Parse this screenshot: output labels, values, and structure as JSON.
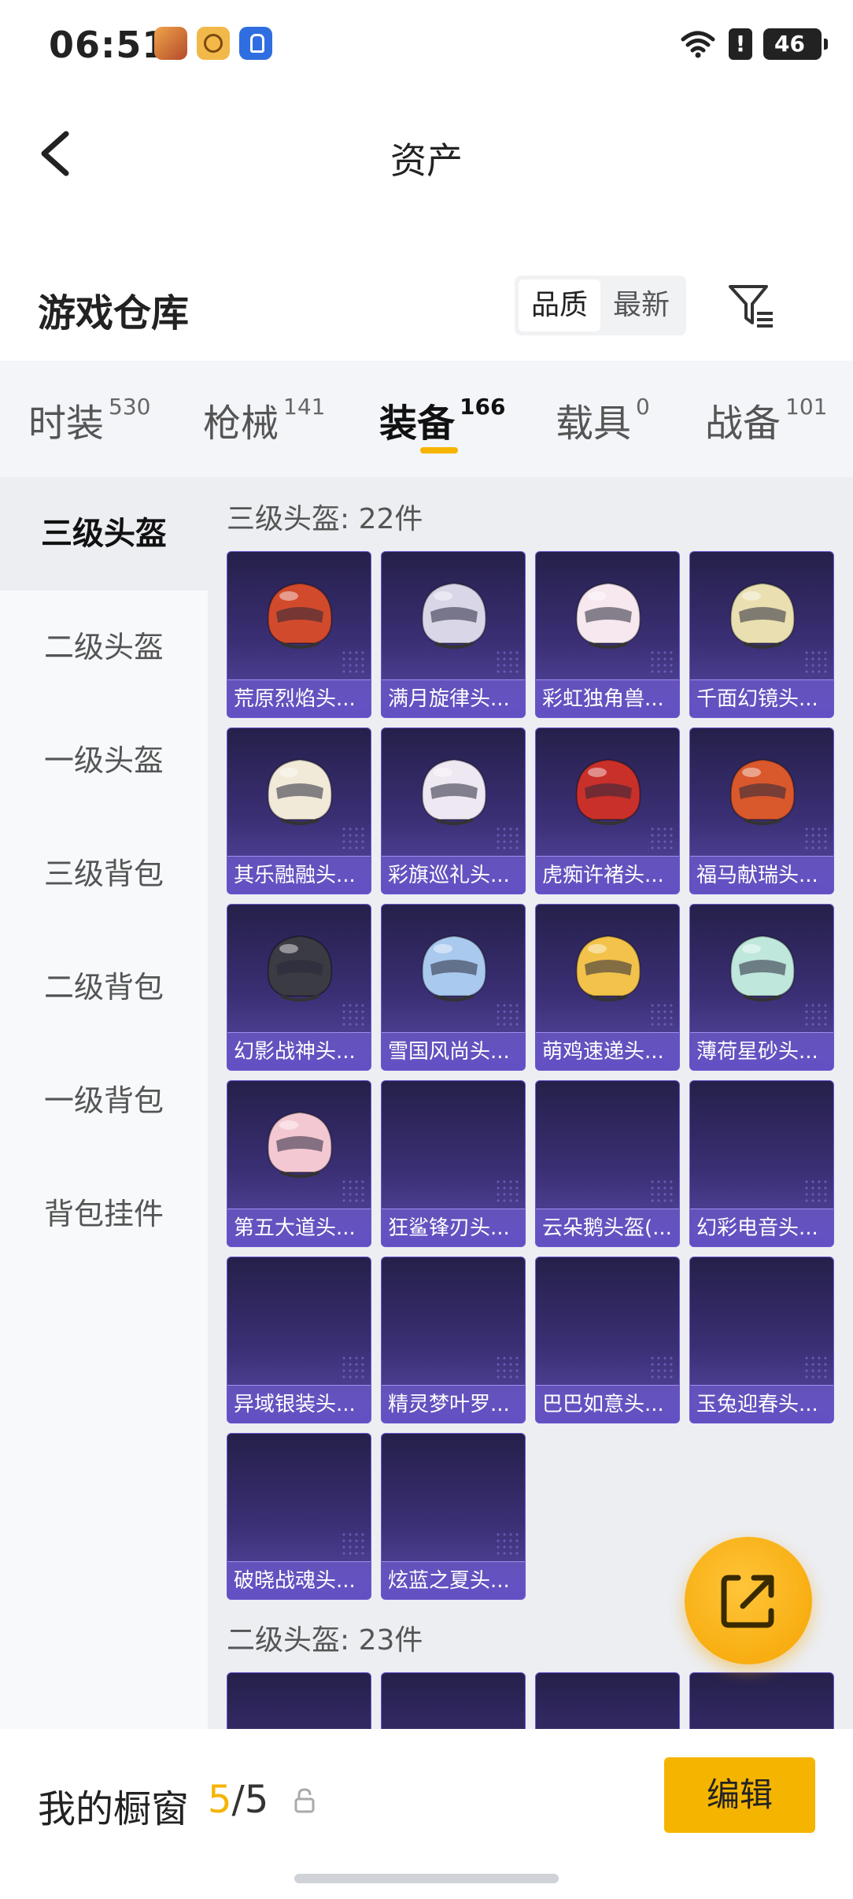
{
  "status": {
    "time": "06:51",
    "battery": "46",
    "alert": "!"
  },
  "header": {
    "title": "资产"
  },
  "warehouse": {
    "title": "游戏仓库",
    "sort_options": [
      "品质",
      "最新"
    ],
    "sort_selected": "品质"
  },
  "tabs": [
    {
      "label": "时装",
      "count": "530"
    },
    {
      "label": "枪械",
      "count": "141"
    },
    {
      "label": "装备",
      "count": "166"
    },
    {
      "label": "载具",
      "count": "0"
    },
    {
      "label": "战备",
      "count": "101"
    }
  ],
  "active_tab": "装备",
  "sidebar": [
    "三级头盔",
    "二级头盔",
    "一级头盔",
    "三级背包",
    "二级背包",
    "一级背包",
    "背包挂件"
  ],
  "section1": {
    "title": "三级头盔: 22件"
  },
  "section2": {
    "title": "二级头盔: 23件"
  },
  "items": [
    "荒原烈焰头...",
    "满月旋律头...",
    "彩虹独角兽...",
    "千面幻镜头...",
    "其乐融融头...",
    "彩旗巡礼头...",
    "虎痴许褚头...",
    "福马献瑞头...",
    "幻影战神头...",
    "雪国风尚头...",
    "萌鸡速递头...",
    "薄荷星砂头...",
    "第五大道头...",
    "狂鲨锋刃头...",
    "云朵鹅头盔(...",
    "幻彩电音头...",
    "异域银装头...",
    "精灵梦叶罗...",
    "巴巴如意头...",
    "玉兔迎春头...",
    "破晓战魂头...",
    "炫蓝之夏头..."
  ],
  "helmet_colors": [
    "#d24a2c",
    "#d9d6e8",
    "#f6e8ee",
    "#e9dfb0",
    "#f1ead8",
    "#eee8f2",
    "#c9302a",
    "#d9582c",
    "#3b3b44",
    "#a9c9ee",
    "#f2c24a",
    "#bfe7dc",
    "#f4c8d2"
  ],
  "bottom": {
    "label": "我的橱窗",
    "current": "5",
    "separator": "/",
    "total": "5",
    "edit": "编辑"
  },
  "colors": {
    "accent": "#f5b400",
    "card_dark": "#25204a",
    "card_light": "#5a4ba8"
  }
}
